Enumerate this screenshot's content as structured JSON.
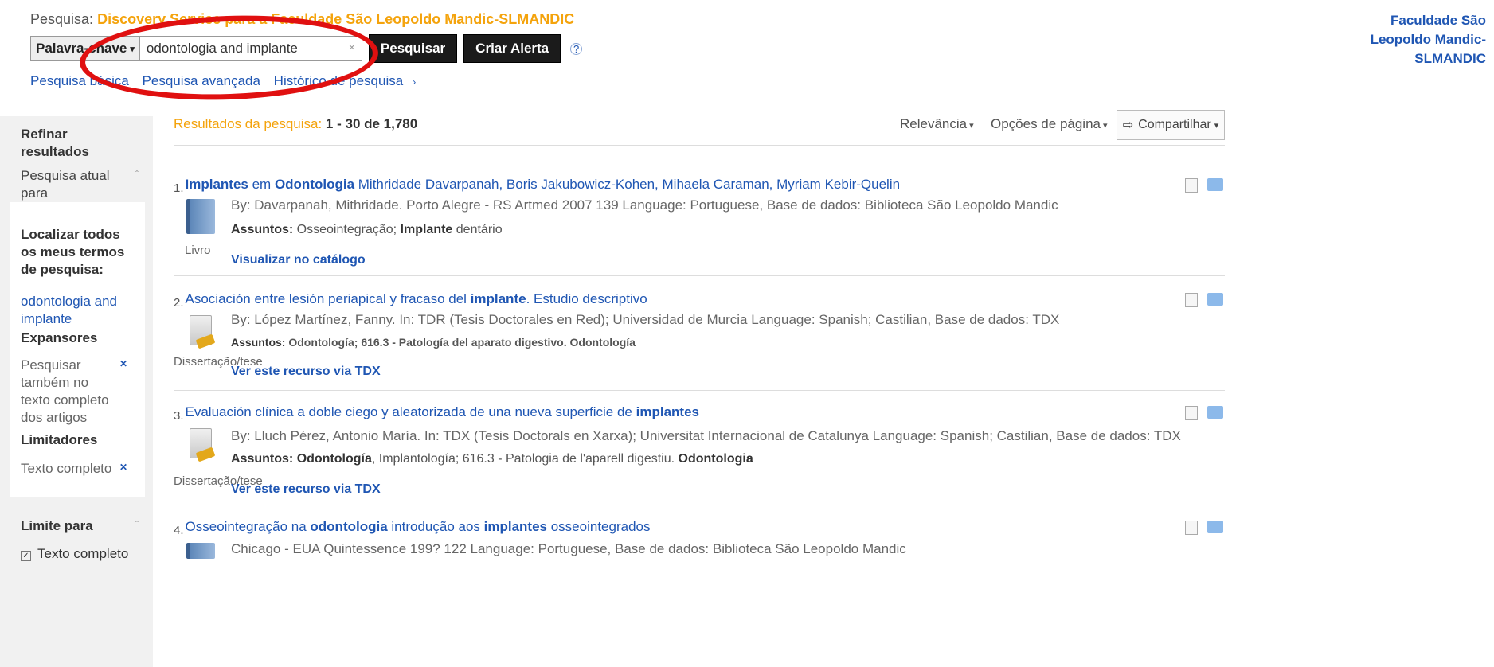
{
  "header": {
    "scope_label": "Pesquisa:",
    "scope_value": "Discovery Service para a Faculdade São Leopoldo Mandic-SLMANDIC",
    "field_select": "Palavra-chave",
    "query": "odontologia and implante",
    "search_button": "Pesquisar",
    "alert_button": "Criar Alerta",
    "help": "?",
    "links": [
      "Pesquisa básica",
      "Pesquisa avançada",
      "Histórico de pesquisa"
    ],
    "institution": [
      "Faculdade São",
      "Leopoldo Mandic-",
      "SLMANDIC"
    ]
  },
  "sidebar": {
    "refine": [
      "Refinar",
      "resultados"
    ],
    "current_search": [
      "Pesquisa atual",
      "para"
    ],
    "find_all": [
      "Localizar todos",
      "os meus termos",
      "de pesquisa:"
    ],
    "terms": [
      "odontologia and",
      "implante"
    ],
    "expanders_heading": "Expansores",
    "expander_text": [
      "Pesquisar",
      "também no",
      "texto completo",
      "dos artigos"
    ],
    "limiters_heading": "Limitadores",
    "limiter_text": "Texto completo",
    "limit_to": "Limite para",
    "limit_checkbox": "Texto completo"
  },
  "results": {
    "label": "Resultados da pesquisa:",
    "range": "1 - 30 de 1,780",
    "sort": "Relevância",
    "page_options": "Opções de página",
    "share": "Compartilhar",
    "items": [
      {
        "num": "1.",
        "title_parts": [
          "Implantes",
          " em ",
          "Odontologia",
          " Mithridade Davarpanah, Boris Jakubowicz-Kohen, Mihaela Caraman, Myriam Kebir-Quelin"
        ],
        "byline": "By: Davarpanah, Mithridade. Porto Alegre - RS Artmed 2007 139 Language: Portuguese, Base de dados: Biblioteca São Leopoldo Mandic",
        "subjects_label": "Assuntos:",
        "subjects_parts": [
          " Osseointegração; ",
          "Implante",
          " dentário"
        ],
        "link": "Visualizar no catálogo",
        "type": "Livro"
      },
      {
        "num": "2.",
        "title_parts": [
          "Asociación entre lesión periapical y fracaso del ",
          "implante",
          ". Estudio descriptivo"
        ],
        "byline": "By: López Martínez, Fanny. In: TDR (Tesis Doctorales en Red); Universidad de Murcia Language: Spanish; Castilian, Base de dados: TDX",
        "subjects_label": "Assuntos:",
        "subjects_parts": [
          " Odontología; 616.3 - Patología del aparato digestivo. Odontología"
        ],
        "link": "Ver este recurso via TDX",
        "type": "Dissertação/tese"
      },
      {
        "num": "3.",
        "title_parts": [
          "Evaluación clínica a doble ciego y aleatorizada de una nueva superficie de ",
          "implantes"
        ],
        "byline": "By: Lluch Pérez, Antonio María. In: TDX (Tesis Doctorals en Xarxa); Universitat Internacional de Catalunya Language: Spanish; Castilian, Base de dados: TDX",
        "subjects_label": "Assuntos:",
        "subjects_parts": [
          " ",
          "Odontología",
          ", Implantología; 616.3 - Patologia de l'aparell digestiu. ",
          "Odontologia"
        ],
        "link": "Ver este recurso via TDX",
        "type": "Dissertação/tese"
      },
      {
        "num": "4.",
        "title_parts": [
          "Osseointegração na ",
          "odontologia",
          " introdução aos ",
          "implantes",
          " osseointegrados"
        ],
        "byline": "Chicago - EUA Quintessence 199? 122 Language: Portuguese, Base de dados: Biblioteca São Leopoldo Mandic"
      }
    ]
  },
  "colors": {
    "accent_orange": "#f4a30c",
    "link_blue": "#1f56b3",
    "annotation_red": "#e01010"
  }
}
